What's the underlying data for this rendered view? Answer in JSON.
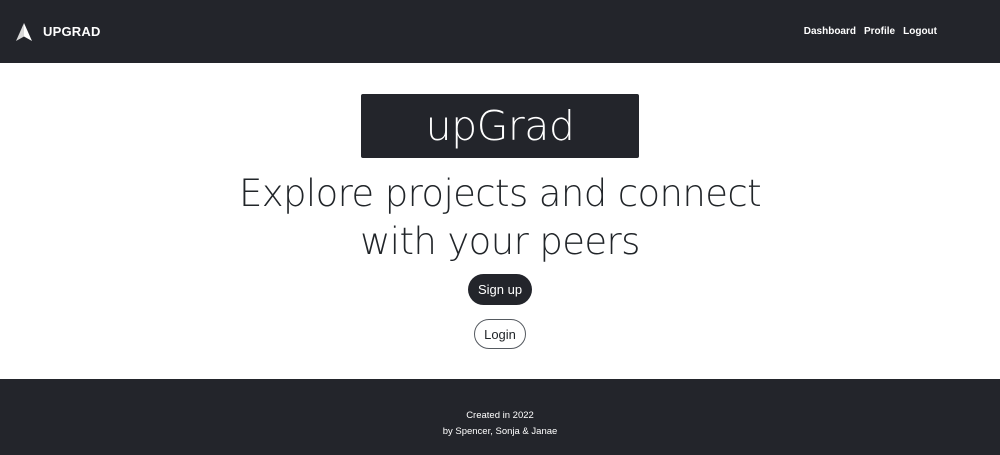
{
  "navbar": {
    "brand_icon": "mountain-peak-icon",
    "brand_text": "UPGRAD",
    "links": [
      "Dashboard",
      "Profile",
      "Logout"
    ]
  },
  "hero": {
    "box_title": "upGrad",
    "headline": "Explore projects and connect with your peers",
    "signup_label": "Sign up",
    "login_label": "Login"
  },
  "footer": {
    "line1": "Created in 2022",
    "line2": "by Spencer, Sonja & Janae"
  },
  "colors": {
    "dark": "#23252b",
    "light": "#ffffff"
  }
}
